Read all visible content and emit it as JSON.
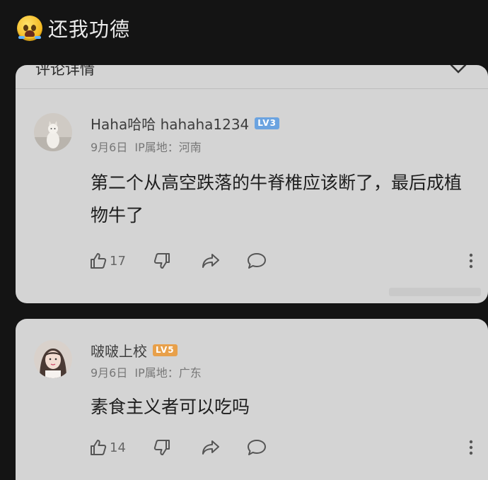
{
  "header": {
    "emoji_icon": "crying-face-icon",
    "title": "还我功德"
  },
  "card_top": {
    "label": "评论详情",
    "close_icon": "close-icon"
  },
  "comments": [
    {
      "username": "Haha哈哈 hahaha1234",
      "level": "LV3",
      "level_color": "#6ba3e0",
      "date": "9月6日",
      "ip": "IP属地：河南",
      "text": "第二个从高空跌落的牛脊椎应该断了，最后成植物牛了",
      "likes": "17"
    },
    {
      "username": "啵啵上校",
      "level": "LV5",
      "level_color": "#e8a04a",
      "date": "9月6日",
      "ip": "IP属地：广东",
      "text": "素食主义者可以吃吗",
      "likes": "14"
    }
  ],
  "colors": {
    "background": "#141414",
    "card": "#d4d4d4",
    "text": "#1e1e1e"
  }
}
